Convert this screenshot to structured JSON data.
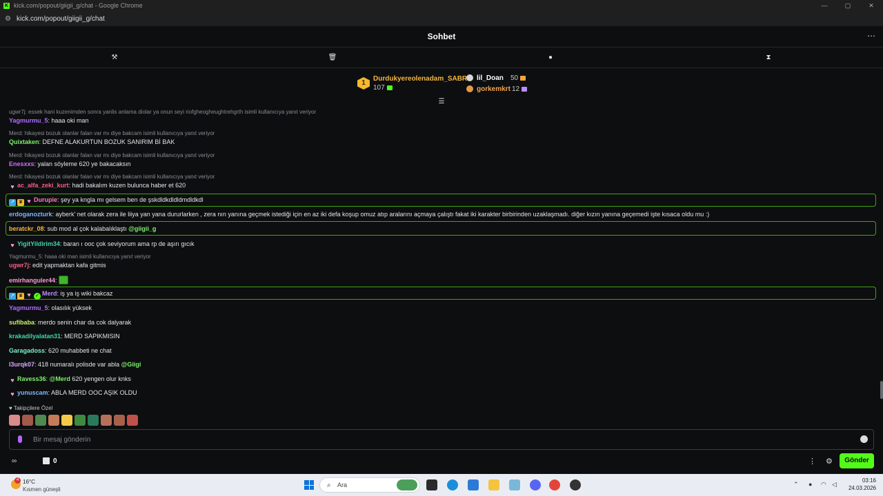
{
  "browser": {
    "window_title": "kick.com/popout/giigii_g/chat - Google Chrome",
    "url": "kick.com/popout/giigii_g/chat",
    "controls": [
      "—",
      "▢",
      "✕"
    ]
  },
  "chat": {
    "title": "Sohbet",
    "more_label": "⋯",
    "toolbar_icons": [
      "hammer-icon",
      "trash-icon",
      "chat-bubble-icon",
      "hourglass-icon"
    ]
  },
  "leaderboard": {
    "first": {
      "rank": "1",
      "name": "Durdukyereolenadam_SABRI",
      "count": "107"
    },
    "second": {
      "name": "lil_Doan",
      "count": "50"
    },
    "third": {
      "name": "gorkemkrt",
      "count": "12"
    }
  },
  "messages": [
    {
      "reply": "ugwr7j: essek hani kuzenimden sonra yanlis anlama diolar ya onun seyi riofgheogheughtrehgrth isimli kullanıcıya yanıt veriyor",
      "user": "Yagmurmu_5",
      "color": "#b06cff",
      "text": ": haaa oki man"
    },
    {
      "reply": "Merd: hikayesi bozuk olanlar falan var mı diye bakcam isimli kullanıcıya yanıt veriyor",
      "user": "Quixtaken",
      "color": "#7cf26a",
      "text": ": DEFNE ALAKURTUN BOZUK SANIRIM Bİ BAK"
    },
    {
      "reply": "Merd: hikayesi bozuk olanlar falan var mı diye bakcam isimli kullanıcıya yanıt veriyor",
      "user": "Enesxxs",
      "color": "#d26cff",
      "text": ": yalan söyleme 620 ye bakacaksın"
    },
    {
      "reply": "Merd: hikayesi bozuk olanlar falan var mı diye bakcam isimli kullanıcıya yanıt veriyor",
      "user": "ac_alfa_zeki_kurt",
      "color": "#ff5c8a",
      "text": ": hadi bakalım kuzen bulunca haber et 620"
    },
    {
      "user": "Durupie",
      "color": "#ff7ab8",
      "text": ": şey ya kngla mı gelsem ben de şskdldkdldldmdldkdl"
    },
    {
      "user": "erdoganozturk",
      "color": "#7ab8ff",
      "text": ": ayberk' net olarak zera ile liiya yan yana dururlarken , zera nın yanına geçmek istediği için en az iki defa koşup omuz atıp aralarını açmaya çalıştı fakat iki karakter birbirinden uzaklaşmadı. diğer kızın yanına geçemedi işte kısaca oldu mu :)"
    },
    {
      "user": "beratckr_08",
      "color": "#f6b63c",
      "text": ": sub mod al çok kalabalıklaştı ",
      "mention": "@giigii_g"
    },
    {
      "user": "YigitYildirim34",
      "color": "#3fd6a8",
      "text": ": baran ı ooc çok seviyorum ama rp de aşırı gıcık"
    },
    {
      "reply": "Yagmurmu_5: haaa oki man isimli kullanıcıya yanıt veriyor",
      "user": "ugwr7j",
      "color": "#ff5c8a",
      "text": ": edit yapmaktan kafa gitmis"
    },
    {
      "user": "emirhanguler44",
      "color": "#ff9ad8",
      "text": ": "
    },
    {
      "user": "Merd",
      "color": "#b98cff",
      "text": ": iş ya iş wiki bakcaz"
    },
    {
      "user": "Yagmurmu_5",
      "color": "#b06cff",
      "text": ": olasılık yüksek"
    },
    {
      "user": "sufibaba",
      "color": "#c8f26a",
      "text": ": merdo senin char da cok dalyarak"
    },
    {
      "user": "krakadilyalatan31",
      "color": "#3fd6a8",
      "text": ": MERD SAPIKMISIN"
    },
    {
      "user": "Garagadoss",
      "color": "#7cf2c8",
      "text": ": 620 muhabbeti ne chat"
    },
    {
      "user": "l3urqk07",
      "color": "#d6a8ff",
      "text": ": 418 numaralı polisde var abla ",
      "mention": "@Giigi"
    },
    {
      "user": "Ravess36",
      "color": "#7cf26a",
      "text": ": ",
      "mention": "@Merd",
      "text2": " 620 yengen olur knks"
    },
    {
      "user": "yunuscam",
      "color": "#7ab8ff",
      "text": ": ABLA MERD OOC AŞIK OLDU"
    }
  ],
  "follower_only_label": "Takipçilere Özel",
  "input": {
    "placeholder": "Bir mesaj gönderin"
  },
  "bottom": {
    "store_count": "0",
    "send_label": "Gönder",
    "dots": "⋮",
    "gear": "⚙"
  },
  "taskbar": {
    "weather_badge": "4",
    "temperature": "16°C",
    "condition": "Kısmen güneşli",
    "search_label": "Ara",
    "time": "03:16",
    "date": "24.03.2026"
  },
  "colors": {
    "accent": "#53fc18",
    "background": "#0d0e10",
    "highlight_border": "#3ea613"
  }
}
